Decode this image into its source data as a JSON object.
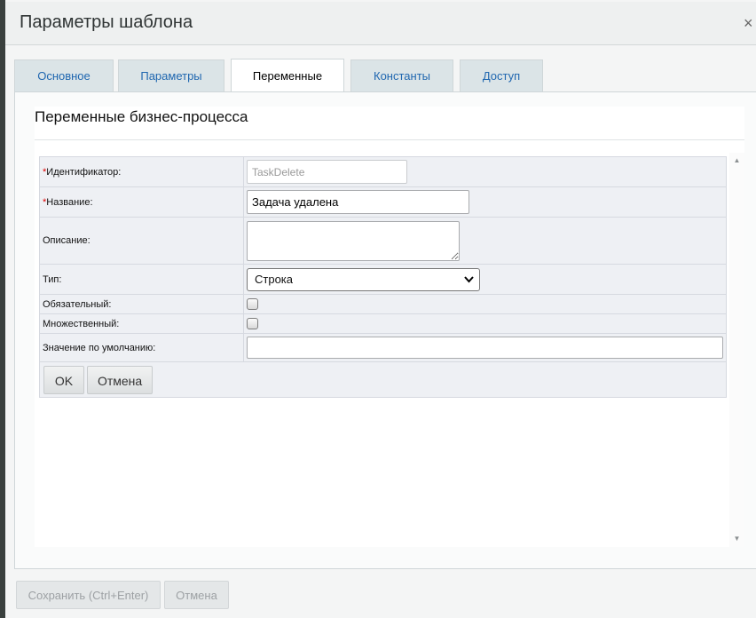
{
  "window": {
    "title": "Параметры шаблона",
    "close_glyph": "×"
  },
  "tabs": [
    {
      "label": "Основное",
      "active": false
    },
    {
      "label": "Параметры",
      "active": false
    },
    {
      "label": "Переменные",
      "active": true
    },
    {
      "label": "Константы",
      "active": false
    },
    {
      "label": "Доступ",
      "active": false
    }
  ],
  "panel": {
    "heading": "Переменные бизнес-процесса"
  },
  "form": {
    "required_mark": "*",
    "id_label": "Идентификатор:",
    "id_value": "TaskDelete",
    "name_label": "Название:",
    "name_value": "Задача удалена",
    "description_label": "Описание:",
    "description_value": "",
    "type_label": "Тип:",
    "type_value": "Строка",
    "required_label": "Обязательный:",
    "multiple_label": "Множественный:",
    "default_label": "Значение по умолчанию:",
    "default_value": "",
    "ok_button": "OK",
    "cancel_button": "Отмена"
  },
  "footer": {
    "save_button": "Сохранить (Ctrl+Enter)",
    "cancel_button": "Отмена"
  },
  "icons": {
    "close": "close-icon",
    "dropdown": "chevron-down-icon",
    "scroll_up": "scroll-up-icon",
    "scroll_down": "scroll-down-icon"
  },
  "colors": {
    "tab_link": "#2067b0",
    "required": "#dd0000",
    "form_bg": "#eef0f4"
  }
}
